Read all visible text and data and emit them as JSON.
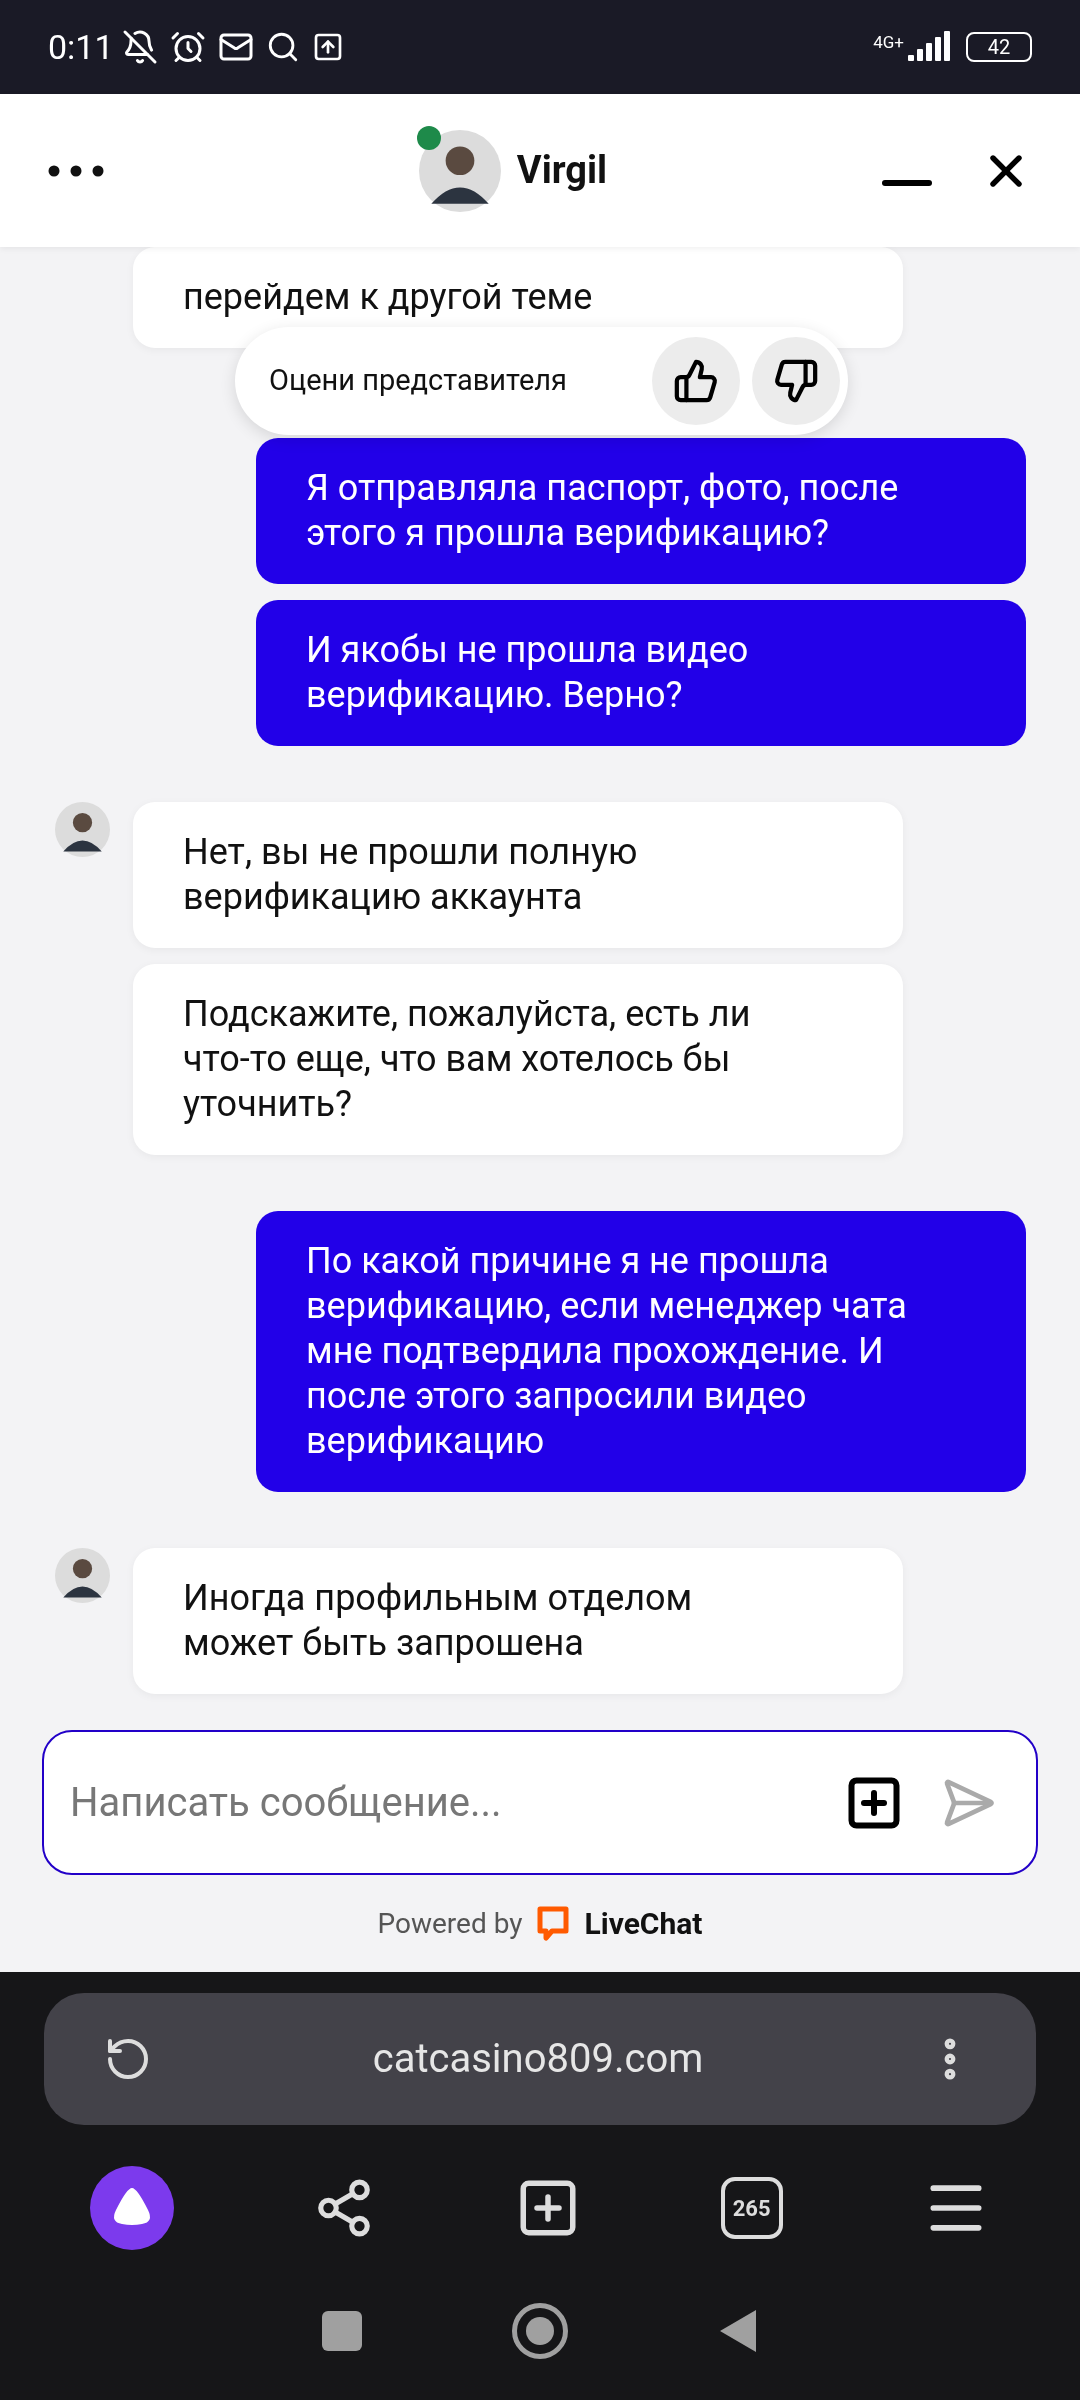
{
  "status_bar": {
    "time": "0:11",
    "network": "4G+",
    "battery": "42"
  },
  "header": {
    "name": "Virgil",
    "online": true
  },
  "rating": {
    "label": "Оцени представителя"
  },
  "messages": [
    {
      "kind": "agent",
      "avatar": false,
      "text": "перейдем к другой теме"
    },
    {
      "kind": "user",
      "text": "Я отправляла паспорт, фото, после этого я прошла верификацию?"
    },
    {
      "kind": "user",
      "text": "И якобы не прошла видео верификацию. Верно?"
    },
    {
      "kind": "agent",
      "avatar": true,
      "text": "Нет, вы не прошли полную верификацию аккаунта"
    },
    {
      "kind": "agent",
      "avatar": false,
      "text": "Подскажите, пожалуйста, есть ли что-то еще, что вам хотелось бы уточнить?"
    },
    {
      "kind": "user",
      "text": "По какой причине я не прошла верификацию, если менеджер чата мне подтвердила прохождение. И после этого запросили видео верификацию"
    },
    {
      "kind": "agent",
      "avatar": true,
      "text": "Иногда профильным отделом может быть запрошена"
    }
  ],
  "composer": {
    "placeholder": "Написать сообщение..."
  },
  "footer": {
    "powered_by": "Powered by",
    "brand": "LiveChat"
  },
  "browser": {
    "url": "catcasino809.com",
    "tabs_count": "265"
  }
}
